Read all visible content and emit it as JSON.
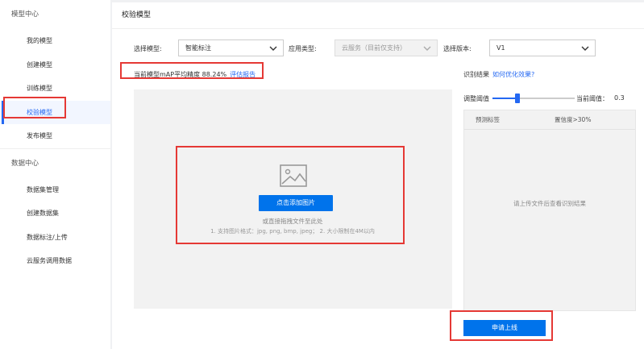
{
  "sidebar": {
    "group1": "模型中心",
    "items1": [
      "我的模型",
      "创建模型",
      "训练模型",
      "校验模型",
      "发布模型"
    ],
    "group2": "数据中心",
    "items2": [
      "数据集管理",
      "创建数据集",
      "数据标注/上传",
      "云服务调用数据"
    ]
  },
  "header": {
    "title": "校验模型"
  },
  "form": {
    "model_label": "选择模型:",
    "model_value": "智能标注",
    "type_label": "应用类型:",
    "type_value": "云服务（目前仅支持）",
    "version_label": "选择版本:",
    "version_value": "V1"
  },
  "map": {
    "text": "当前模型mAP平均精度 88.24%",
    "link": "评估报告"
  },
  "upload": {
    "button": "点击添加图片",
    "hint1": "或直接拖拽文件至此处",
    "hint2": "1. 支持图片格式：jpg, png, bmp, jpeg； 2. 大小限制在4M以内"
  },
  "result": {
    "title": "识别结果",
    "link": "如何优化效果?",
    "adjust_label": "调整阈值",
    "current_label": "当前阈值：",
    "current_value": "0.3",
    "threshold": 0.3,
    "col_label": "预测标签",
    "col_conf": "置信度>30%",
    "empty": "请上传文件后查看识别结果"
  },
  "apply_button": "申请上线",
  "colors": {
    "accent": "#2468f2",
    "button": "#0073eb",
    "highlight": "#e53935"
  }
}
